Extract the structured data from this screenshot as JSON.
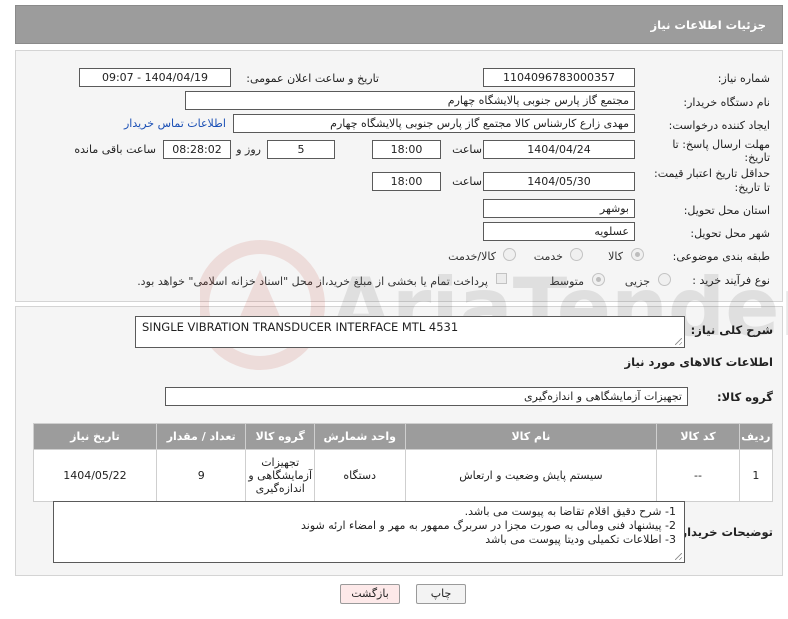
{
  "header": {
    "title": "جزئیات اطلاعات نیاز"
  },
  "fields": {
    "need_number_label": "شماره نیاز:",
    "need_number": "1104096783000357",
    "announce_label": "تاریخ و ساعت اعلان عمومی:",
    "announce_value": "1404/04/19 - 09:07",
    "buyer_org_label": "نام دستگاه خریدار:",
    "buyer_org": "مجتمع گاز پارس جنوبی  پالایشگاه چهارم",
    "creator_label": "ایجاد کننده درخواست:",
    "creator": "مهدی زارع کارشناس کالا مجتمع گاز پارس جنوبی  پالایشگاه چهارم",
    "contact_link": "اطلاعات تماس خریدار",
    "reply_deadline_label_1": "مهلت ارسال پاسخ: تا",
    "reply_deadline_label_2": "تاریخ:",
    "reply_date": "1404/04/24",
    "time_label": "ساعت",
    "reply_time": "18:00",
    "days_value": "5",
    "days_label": "روز و",
    "remaining_time": "08:28:02",
    "remaining_label": "ساعت باقی مانده",
    "price_validity_label_1": "حداقل تاریخ اعتبار قیمت:",
    "price_validity_label_2": "تا تاریخ:",
    "price_date": "1404/05/30",
    "price_time": "18:00",
    "province_label": "استان محل تحویل:",
    "province": "بوشهر",
    "city_label": "شهر محل تحویل:",
    "city": "عسلویه",
    "category_label": "طبقه بندی موضوعی:",
    "category_options": [
      "کالا",
      "خدمت",
      "کالا/خدمت"
    ],
    "process_label": "نوع فرآیند خرید :",
    "process_options": [
      "جزیی",
      "متوسط"
    ],
    "payment_note": "پرداخت تمام یا بخشی از مبلغ خرید،از محل \"اسناد خزانه اسلامی\" خواهد بود."
  },
  "description": {
    "label": "شرح کلی نیاز:",
    "value": "SINGLE VIBRATION TRANSDUCER INTERFACE MTL 4531"
  },
  "goods": {
    "section_title": "اطلاعات کالاهای مورد نیاز",
    "group_label": "گروه کالا:",
    "group_value": "تجهیزات آزمایشگاهی و اندازه‌گیری"
  },
  "table": {
    "headers": [
      "ردیف",
      "کد کالا",
      "نام کالا",
      "واحد شمارش",
      "گروه کالا",
      "تعداد / مقدار",
      "تاریخ نیاز"
    ],
    "rows": [
      {
        "row": "1",
        "code": "--",
        "name": "سیستم پایش وضعیت و ارتعاش",
        "unit": "دستگاه",
        "group_lines": [
          "تجهیزات",
          "آزمایشگاهی و",
          "اندازه‌گیری"
        ],
        "qty": "9",
        "date": "1404/05/22"
      }
    ]
  },
  "notes": {
    "label": "توضیحات خریدار:",
    "lines": [
      "1- شرح دقیق اقلام تقاضا به پیوست می باشد.",
      "2- پیشنهاد فنی ومالی به صورت مجزا در سربرگ ممهور به مهر و امضاء ارئه شوند",
      "3- اطلاعات تکمیلی ودیتا پیوست می باشد"
    ]
  },
  "buttons": {
    "print": "چاپ",
    "back": "بازگشت"
  },
  "watermark": {
    "text": "AriaTender.neT"
  },
  "colors": {
    "header_bg": "#9c9c9c",
    "link": "#1a4fb5",
    "back_btn": "#fde9e9"
  }
}
